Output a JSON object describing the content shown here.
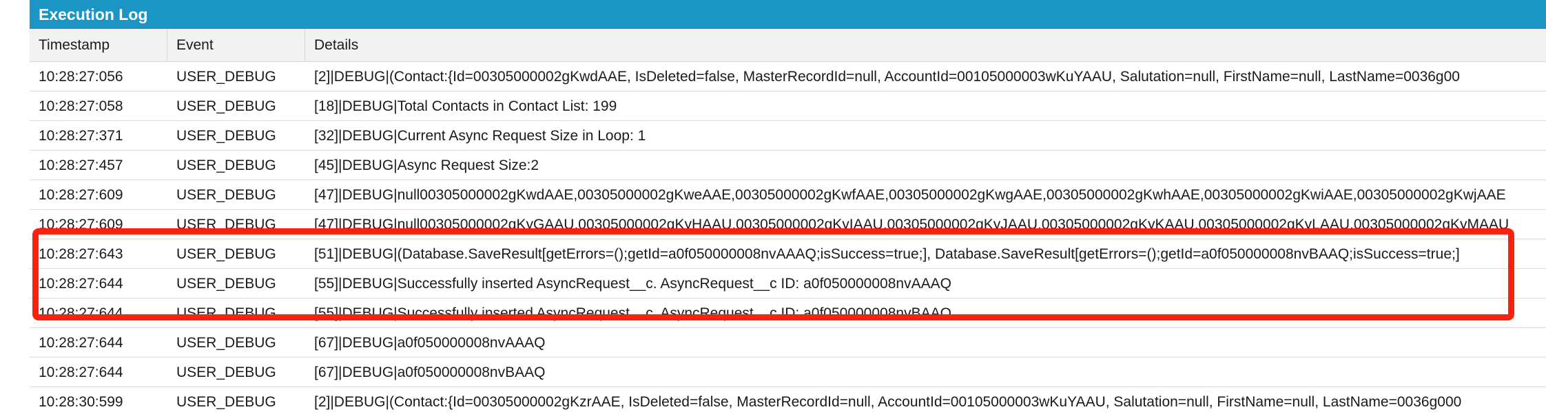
{
  "panel": {
    "title": "Execution Log"
  },
  "columns": {
    "timestamp": "Timestamp",
    "event": "Event",
    "details": "Details"
  },
  "rows": [
    {
      "timestamp": "10:28:27:056",
      "event": "USER_DEBUG",
      "details": "[2]|DEBUG|(Contact:{Id=00305000002gKwdAAE, IsDeleted=false, MasterRecordId=null, AccountId=00105000003wKuYAAU, Salutation=null, FirstName=null, LastName=0036g00"
    },
    {
      "timestamp": "10:28:27:058",
      "event": "USER_DEBUG",
      "details": "[18]|DEBUG|Total Contacts in Contact List: 199"
    },
    {
      "timestamp": "10:28:27:371",
      "event": "USER_DEBUG",
      "details": "[32]|DEBUG|Current Async Request Size in Loop: 1"
    },
    {
      "timestamp": "10:28:27:457",
      "event": "USER_DEBUG",
      "details": "[45]|DEBUG|Async Request Size:2"
    },
    {
      "timestamp": "10:28:27:609",
      "event": "USER_DEBUG",
      "details": "[47]|DEBUG|null00305000002gKwdAAE,00305000002gKweAAE,00305000002gKwfAAE,00305000002gKwgAAE,00305000002gKwhAAE,00305000002gKwiAAE,00305000002gKwjAAE"
    },
    {
      "timestamp": "10:28:27:609",
      "event": "USER_DEBUG",
      "details": "[47]|DEBUG|null00305000002gKyGAAU,00305000002gKyHAAU,00305000002gKyIAAU,00305000002gKyJAAU,00305000002gKyKAAU,00305000002gKyLAAU,00305000002gKyMAAU"
    },
    {
      "timestamp": "10:28:27:643",
      "event": "USER_DEBUG",
      "details": "[51]|DEBUG|(Database.SaveResult[getErrors=();getId=a0f050000008nvAAAQ;isSuccess=true;], Database.SaveResult[getErrors=();getId=a0f050000008nvBAAQ;isSuccess=true;]"
    },
    {
      "timestamp": "10:28:27:644",
      "event": "USER_DEBUG",
      "details": "[55]|DEBUG|Successfully inserted AsyncRequest__c. AsyncRequest__c ID: a0f050000008nvAAAQ"
    },
    {
      "timestamp": "10:28:27:644",
      "event": "USER_DEBUG",
      "details": "[55]|DEBUG|Successfully inserted AsyncRequest__c. AsyncRequest__c ID: a0f050000008nvBAAQ"
    },
    {
      "timestamp": "10:28:27:644",
      "event": "USER_DEBUG",
      "details": "[67]|DEBUG|a0f050000008nvAAAQ"
    },
    {
      "timestamp": "10:28:27:644",
      "event": "USER_DEBUG",
      "details": "[67]|DEBUG|a0f050000008nvBAAQ"
    },
    {
      "timestamp": "10:28:30:599",
      "event": "USER_DEBUG",
      "details": "[2]|DEBUG|(Contact:{Id=00305000002gKzrAAE, IsDeleted=false, MasterRecordId=null, AccountId=00105000003wKuYAAU, Salutation=null, FirstName=null, LastName=0036g000"
    }
  ],
  "colors": {
    "header_bg": "#1b96c4",
    "highlight": "#ff1f0f"
  }
}
